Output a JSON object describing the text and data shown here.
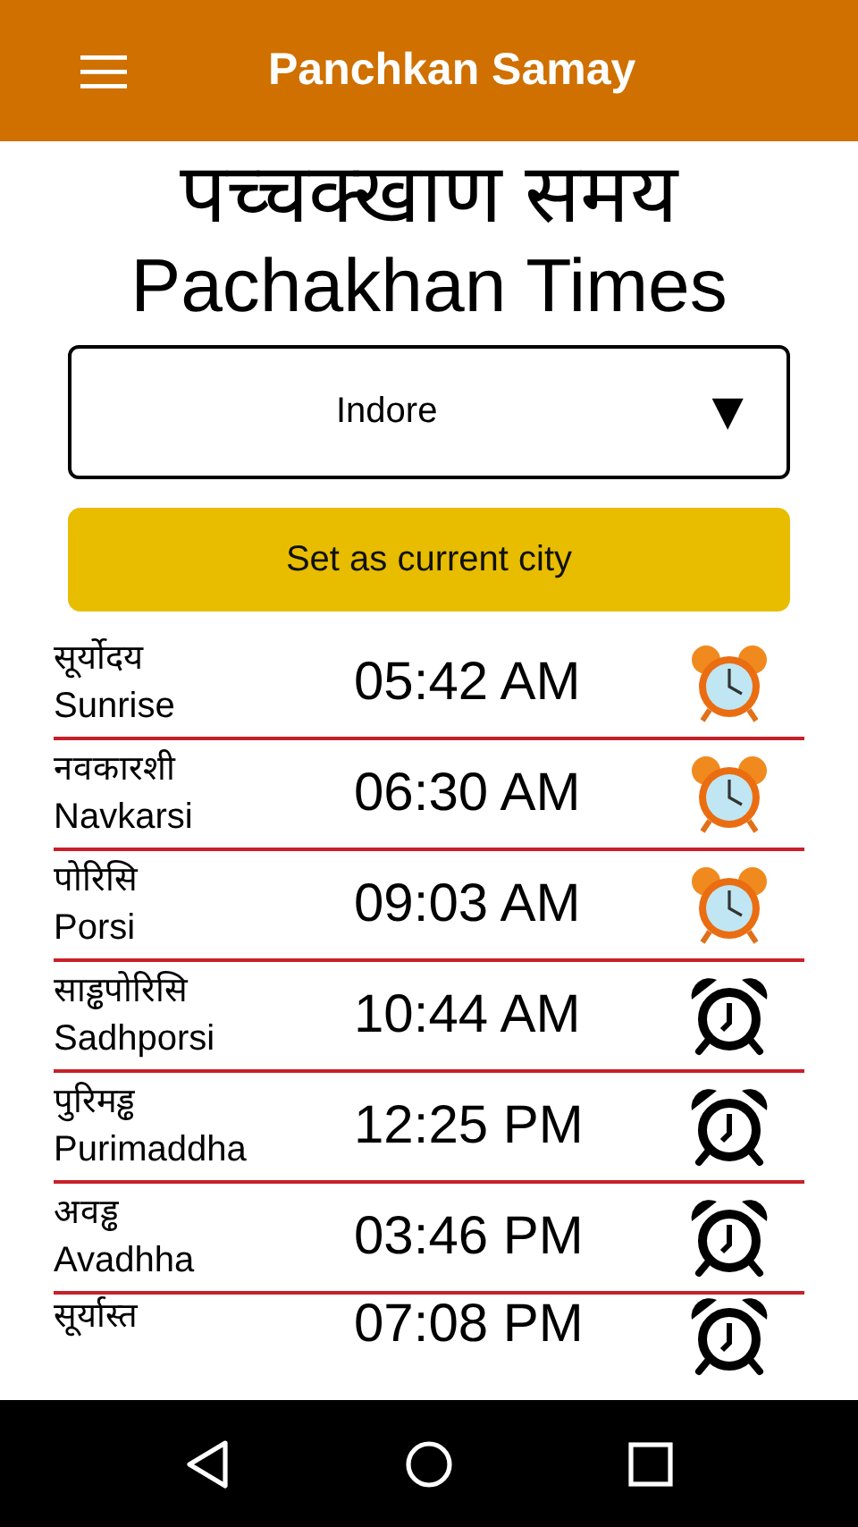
{
  "app_bar": {
    "title": "Panchkan Samay"
  },
  "heading": {
    "hindi": "पच्चक्खाण समय",
    "english": "Pachakhan Times"
  },
  "city_select": {
    "value": "Indore",
    "arrow": "▼"
  },
  "set_city_button": {
    "label": "Set as current city"
  },
  "times": [
    {
      "hindi": "सूर्योदय",
      "english": "Sunrise",
      "time": "05:42 AM",
      "past": true
    },
    {
      "hindi": "नवकारशी",
      "english": "Navkarsi",
      "time": "06:30 AM",
      "past": true
    },
    {
      "hindi": "पोरिसि",
      "english": "Porsi",
      "time": "09:03 AM",
      "past": true
    },
    {
      "hindi": "साड्ढपोरिसि",
      "english": "Sadhporsi",
      "time": "10:44 AM",
      "past": false
    },
    {
      "hindi": "पुरिमड्ढ",
      "english": "Purimaddha",
      "time": "12:25 PM",
      "past": false
    },
    {
      "hindi": "अवड्ढ",
      "english": "Avadhha",
      "time": "03:46 PM",
      "past": false
    },
    {
      "hindi": "सूर्यास्त",
      "time": "07:08 PM",
      "past": false
    }
  ]
}
